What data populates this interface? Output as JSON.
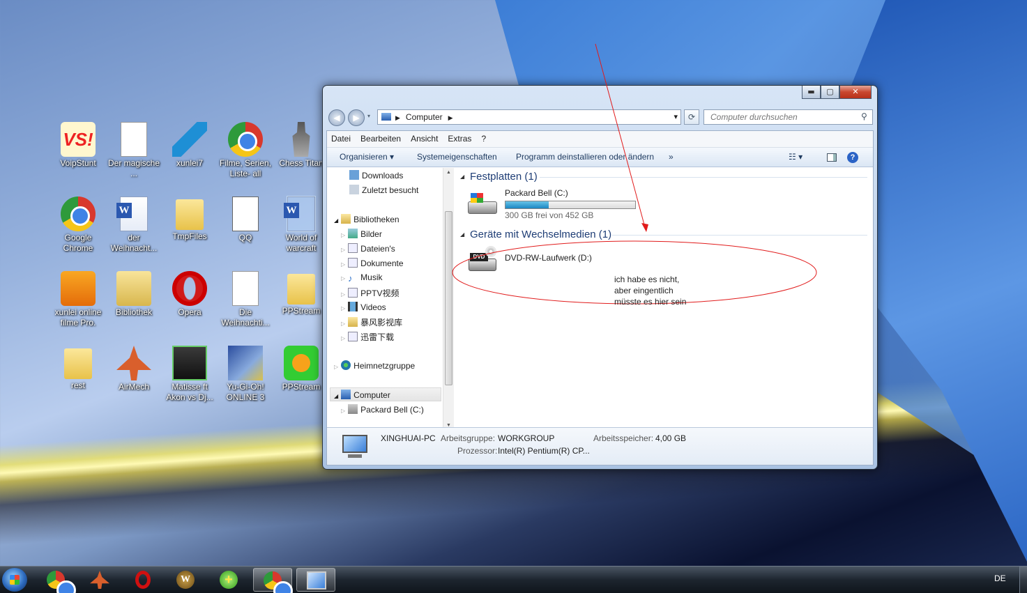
{
  "desktop_icons": [
    {
      "label": "VoipStunt"
    },
    {
      "label": "Der magische ..."
    },
    {
      "label": "xunlei7"
    },
    {
      "label": "Filme, Serien, Liste- all"
    },
    {
      "label": "Chess Titan"
    },
    {
      "label": "Google Chrome"
    },
    {
      "label": "der Weihnacht..."
    },
    {
      "label": "TmpFiles"
    },
    {
      "label": "QQ"
    },
    {
      "label": "World of warcraft"
    },
    {
      "label": "xunlei online filme Pro."
    },
    {
      "label": "Bibliothek"
    },
    {
      "label": "Opera"
    },
    {
      "label": "Die Weihnachti..."
    },
    {
      "label": "PPStream"
    },
    {
      "label": "rest"
    },
    {
      "label": "AirMech"
    },
    {
      "label": "Matisse ft Akon vs Dj..."
    },
    {
      "label": "Yu-Gi-Oh! ONLINE 3"
    },
    {
      "label": "PPStream"
    }
  ],
  "window": {
    "caption_buttons": {
      "minimize": "▬",
      "maximize": "▢",
      "close": "✕"
    },
    "address": {
      "crumb": "Computer",
      "dropdown": "▾"
    },
    "search_placeholder": "Computer durchsuchen",
    "menu": [
      "Datei",
      "Bearbeiten",
      "Ansicht",
      "Extras",
      "?"
    ],
    "commands": {
      "organize": "Organisieren ▾",
      "system_properties": "Systemeigenschaften",
      "uninstall": "Programm deinstallieren oder ändern",
      "more": "»"
    },
    "nav_tree": {
      "favorites": [
        "Downloads",
        "Zuletzt besucht"
      ],
      "libraries_label": "Bibliotheken",
      "libraries": [
        "Bilder",
        "Dateien's",
        "Dokumente",
        "Musik",
        "PPTV视频",
        "Videos",
        "暴风影视库",
        "迅雷下载"
      ],
      "homegroup": "Heimnetzgruppe",
      "computer": "Computer",
      "computer_children": [
        "Packard Bell (C:)"
      ]
    },
    "groups": {
      "hard_disks": {
        "title": "Festplatten (1)",
        "drive_name": "Packard Bell (C:)",
        "free_text": "300 GB frei von 452 GB",
        "used_fraction": 0.336
      },
      "removable": {
        "title": "Geräte mit Wechselmedien (1)",
        "drive_name": "DVD-RW-Laufwerk (D:)",
        "dvd_badge": "DVD"
      }
    },
    "details": {
      "pc_name": "XINGHUAI-PC",
      "workgroup_label": "Arbeitsgruppe:",
      "workgroup": "WORKGROUP",
      "memory_label": "Arbeitsspeicher:",
      "memory": "4,00 GB",
      "cpu_label": "Prozessor:",
      "cpu": "Intel(R) Pentium(R) CP..."
    }
  },
  "annotation": {
    "line1": "ich habe es nicht,",
    "line2": "aber eingentlich",
    "line3": "müsste es hier sein",
    "color": "#e11b1b"
  },
  "taskbar": {
    "lang": "DE"
  }
}
